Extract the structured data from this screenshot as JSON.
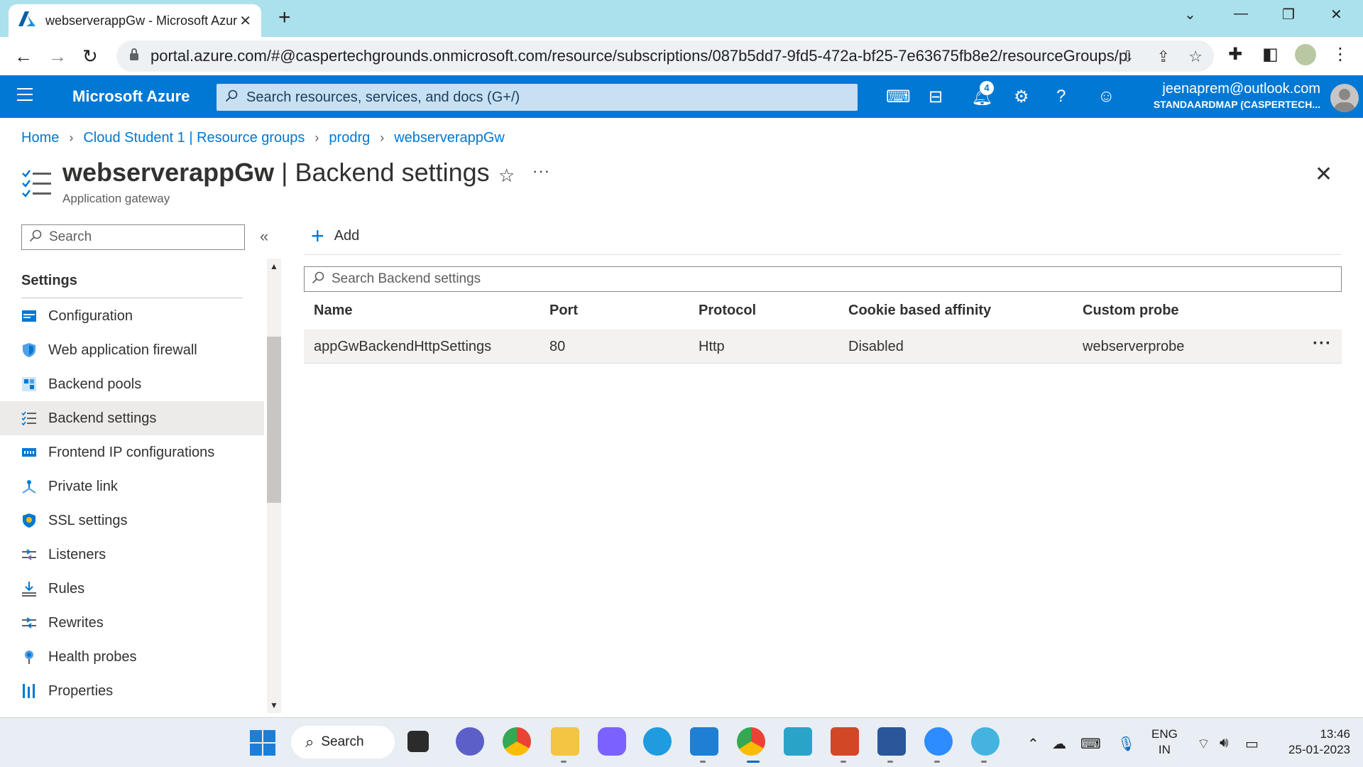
{
  "browser": {
    "tab_title": "webserverappGw - Microsoft Azure",
    "url": "portal.azure.com/#@caspertechgrounds.onmicrosoft.com/resource/subscriptions/087b5dd7-9fd5-472a-bf25-7e63675fb8e2/resourceGroups/pr..."
  },
  "azure": {
    "brand": "Microsoft Azure",
    "search_placeholder": "Search resources, services, and docs (G+/)",
    "notification_count": "4",
    "account_email": "jeenaprem@outlook.com",
    "account_tenant": "STANDAARDMAP (CASPERTECH..."
  },
  "breadcrumb": [
    "Home",
    "Cloud Student 1 | Resource groups",
    "prodrg",
    "webserverappGw"
  ],
  "blade": {
    "resource": "webserverappGw",
    "page": "Backend settings",
    "separator": " | ",
    "subtitle": "Application gateway"
  },
  "menu": {
    "search_placeholder": "Search",
    "section": "Settings",
    "items": [
      {
        "label": "Configuration",
        "icon": "configuration-icon"
      },
      {
        "label": "Web application firewall",
        "icon": "waf-shield-icon"
      },
      {
        "label": "Backend pools",
        "icon": "backend-pools-icon"
      },
      {
        "label": "Backend settings",
        "icon": "backend-settings-icon",
        "active": true
      },
      {
        "label": "Frontend IP configurations",
        "icon": "frontend-ip-icon"
      },
      {
        "label": "Private link",
        "icon": "private-link-icon"
      },
      {
        "label": "SSL settings",
        "icon": "ssl-shield-icon"
      },
      {
        "label": "Listeners",
        "icon": "listeners-icon"
      },
      {
        "label": "Rules",
        "icon": "rules-icon"
      },
      {
        "label": "Rewrites",
        "icon": "rewrites-icon"
      },
      {
        "label": "Health probes",
        "icon": "health-probes-icon"
      },
      {
        "label": "Properties",
        "icon": "properties-icon"
      }
    ]
  },
  "content": {
    "add_label": "Add",
    "search_placeholder": "Search Backend settings",
    "columns": [
      "Name",
      "Port",
      "Protocol",
      "Cookie based affinity",
      "Custom probe"
    ],
    "rows": [
      {
        "name": "appGwBackendHttpSettings",
        "port": "80",
        "protocol": "Http",
        "affinity": "Disabled",
        "probe": "webserverprobe"
      }
    ]
  },
  "taskbar": {
    "search_label": "Search",
    "lang_line1": "ENG",
    "lang_line2": "IN",
    "time": "13:46",
    "date": "25-01-2023"
  },
  "colors": {
    "azure_blue": "#0078d4",
    "tabstrip": "#abe1ec",
    "active_menu": "#edebe9"
  }
}
